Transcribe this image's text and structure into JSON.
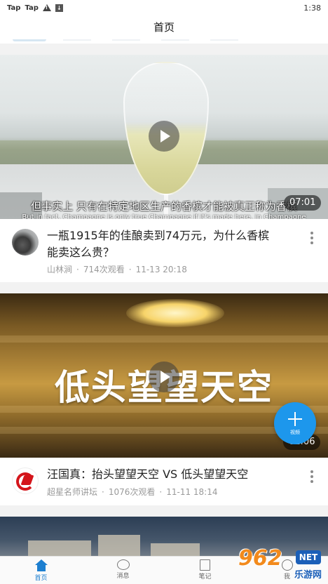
{
  "status_bar": {
    "left_labels": [
      "Tap",
      "Tap"
    ],
    "time": "1:38"
  },
  "header": {
    "title": "首页"
  },
  "feed": [
    {
      "subtitle_zh": "但事实上 只有在特定地区生产的香槟才能被真正称为香槟",
      "subtitle_en": "But in fact, Champagne is only true Champagne if it's made here, in Champagne",
      "duration": "07:01",
      "title": "一瓶1915年的佳酿卖到74万元，为什么香槟能卖这么贵？",
      "author": "山林涧",
      "views": "714次观看",
      "time": "11-13 20:18"
    },
    {
      "video_text": "低头望望天空",
      "duration": "01:06",
      "title": "汪国真：抬头望望天空 VS 低头望望天空",
      "author": "超星名师讲坛",
      "views": "1076次观看",
      "time": "11-11 18:14"
    }
  ],
  "fab": {
    "label": "视频"
  },
  "bottom_nav": [
    {
      "label": "首页",
      "icon": "home-icon",
      "active": true
    },
    {
      "label": "消息",
      "icon": "message-icon",
      "active": false
    },
    {
      "label": "笔记",
      "icon": "note-icon",
      "active": false
    },
    {
      "label": "我",
      "icon": "profile-icon",
      "active": false
    }
  ],
  "watermark": {
    "main": "962",
    "badge": "NET",
    "sub": "乐游网"
  },
  "colors": {
    "accent": "#1d97ec",
    "nav_active": "#1d7fd0",
    "meta_text": "#9a9a9a"
  }
}
